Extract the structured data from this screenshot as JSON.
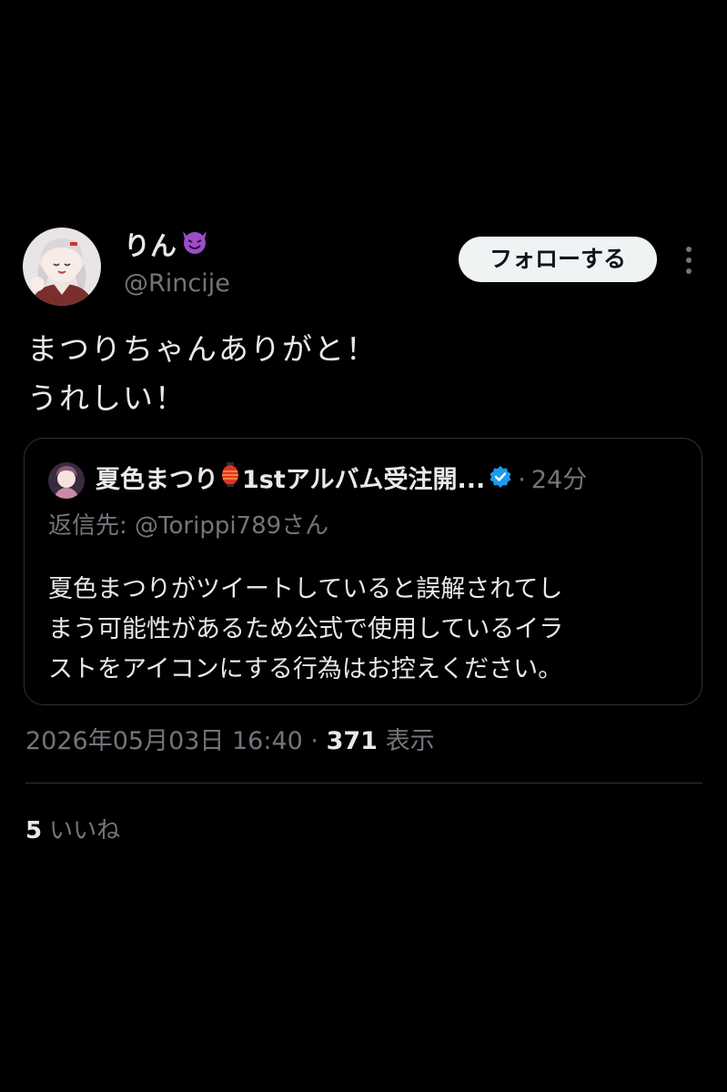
{
  "author": {
    "display_name": "りん",
    "handle": "@Rincije",
    "avatar": "anime-girl-avatar",
    "name_emoji": "smiling-devil-icon"
  },
  "follow_button": {
    "label": "フォローする"
  },
  "more_button": {
    "icon": "vertical-ellipsis-icon"
  },
  "tweet": {
    "lines": [
      "まつりちゃんありがと！",
      "うれしい！"
    ]
  },
  "quote": {
    "display_name": "夏色まつり",
    "name_emoji": "red-lantern-icon",
    "name_suffix": "1stアルバム受注開...",
    "verified_icon": "blue-verified-badge-icon",
    "separator": "·",
    "time": "24分",
    "reply_to_label": "返信先:",
    "reply_to_handle": "@Torippi789さん",
    "lines": [
      "夏色まつりがツイートしていると誤解されてし",
      "まう可能性があるため公式で使用しているイラ",
      "ストをアイコンにする行為はお控えください。"
    ]
  },
  "meta": {
    "datetime": "2026年05月03日 16:40",
    "separator": "·",
    "views_count": "371",
    "views_label": "表示"
  },
  "likes": {
    "count": "5",
    "label": "いいね"
  },
  "colors": {
    "background": "#000000",
    "text_primary": "#e7e9ea",
    "text_secondary": "#71767b",
    "border": "#2f3336",
    "verified_blue": "#1d9bf0",
    "devil_purple": "#9b4dca"
  }
}
